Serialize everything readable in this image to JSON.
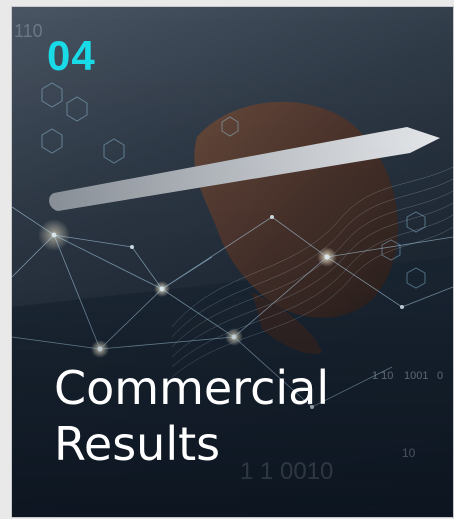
{
  "card": {
    "number": "04",
    "title_line1": "Commercial",
    "title_line2": "Results",
    "accent_color": "#19dbe8",
    "background_image": "hand-with-stylus-digital-network",
    "background_digits": [
      "110",
      "1 10",
      "1001",
      "0",
      "1 1",
      "0010",
      "10"
    ]
  }
}
